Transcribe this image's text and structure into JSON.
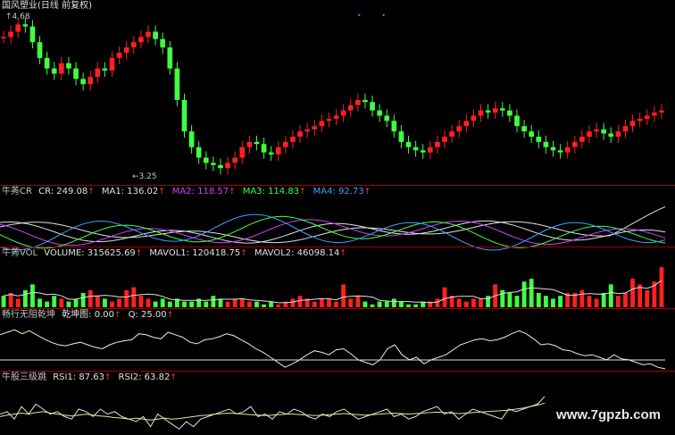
{
  "title": "国风塑业(日线 前复权)",
  "price_high": "4.68",
  "price_low": "3.25",
  "cr_panel": {
    "name": "牛莠CR",
    "items": [
      {
        "label": "CR: 249.08",
        "color": "#e0e0e0"
      },
      {
        "label": "MA1: 136.02",
        "color": "#e0e0e0"
      },
      {
        "label": "MA2: 118.57",
        "color": "#d040ff"
      },
      {
        "label": "MA3: 114.83",
        "color": "#40ff40"
      },
      {
        "label": "MA4: 92.73",
        "color": "#40a0ff"
      }
    ]
  },
  "vol_panel": {
    "name": "牛莠VOL",
    "items": [
      {
        "label": "VOLUME: 315625.69",
        "color": "#e0e0e0"
      },
      {
        "label": "MAVOL1: 120418.75",
        "color": "#e0e0e0"
      },
      {
        "label": "MAVOL2: 46098.14",
        "color": "#e0e0e0"
      }
    ]
  },
  "qk_panel": {
    "name": "畅行无阻乾坤",
    "items": [
      {
        "label": "乾坤图: 0.00",
        "color": "#e0e0e0"
      },
      {
        "label": "Q: 25.00",
        "color": "#e0e0e0"
      }
    ]
  },
  "rsi_panel": {
    "name": "牛股三级跳",
    "items": [
      {
        "label": "RSI1: 87.63",
        "color": "#e0e0e0"
      },
      {
        "label": "RSI2: 63.82",
        "color": "#e0e0e0"
      }
    ]
  },
  "watermark": "www.7gpzb.com",
  "colors": {
    "up": "#ff2020",
    "down": "#40ff40",
    "separator": "#a00000",
    "line": "#f0f0c0"
  },
  "chart_data": {
    "type": "line",
    "price_series": [
      4.5,
      4.55,
      4.62,
      4.6,
      4.45,
      4.3,
      4.2,
      4.15,
      4.25,
      4.2,
      4.1,
      4.05,
      4.12,
      4.2,
      4.18,
      4.3,
      4.35,
      4.4,
      4.45,
      4.5,
      4.55,
      4.48,
      4.4,
      4.2,
      3.9,
      3.6,
      3.45,
      3.35,
      3.3,
      3.28,
      3.25,
      3.3,
      3.35,
      3.45,
      3.5,
      3.48,
      3.4,
      3.38,
      3.45,
      3.5,
      3.55,
      3.6,
      3.62,
      3.65,
      3.7,
      3.72,
      3.75,
      3.8,
      3.85,
      3.9,
      3.88,
      3.8,
      3.75,
      3.7,
      3.6,
      3.5,
      3.45,
      3.42,
      3.4,
      3.45,
      3.5,
      3.55,
      3.6,
      3.65,
      3.7,
      3.75,
      3.8,
      3.78,
      3.82,
      3.8,
      3.75,
      3.65,
      3.6,
      3.55,
      3.5,
      3.45,
      3.42,
      3.4,
      3.45,
      3.5,
      3.55,
      3.6,
      3.62,
      3.58,
      3.55,
      3.6,
      3.65,
      3.7,
      3.72,
      3.75,
      3.78,
      3.8
    ],
    "volume_series": [
      0.4,
      0.5,
      0.3,
      0.6,
      0.8,
      0.3,
      0.2,
      0.4,
      0.3,
      0.2,
      0.3,
      0.5,
      0.6,
      0.4,
      0.3,
      0.2,
      0.3,
      0.6,
      0.7,
      0.4,
      0.3,
      0.2,
      0.3,
      0.2,
      0.3,
      0.2,
      0.2,
      0.3,
      0.2,
      0.4,
      0.3,
      0.2,
      0.3,
      0.3,
      0.2,
      0.2,
      0.1,
      0.2,
      0.1,
      0.2,
      0.3,
      0.4,
      0.3,
      0.2,
      0.3,
      0.3,
      0.2,
      0.8,
      0.3,
      0.4,
      0.2,
      0.1,
      0.2,
      0.2,
      0.3,
      0.2,
      0.1,
      0.1,
      0.2,
      0.2,
      0.3,
      0.7,
      0.4,
      0.3,
      0.2,
      0.3,
      0.3,
      0.4,
      0.8,
      0.6,
      0.5,
      0.4,
      0.9,
      1.0,
      0.5,
      0.4,
      0.3,
      0.4,
      0.5,
      0.5,
      0.6,
      0.4,
      0.3,
      0.5,
      0.8,
      0.4,
      0.5,
      1.0,
      0.8,
      0.6,
      0.9,
      1.4
    ],
    "qk_series": [
      0.7,
      0.75,
      0.8,
      0.72,
      0.78,
      0.7,
      0.62,
      0.55,
      0.5,
      0.48,
      0.52,
      0.55,
      0.5,
      0.45,
      0.42,
      0.5,
      0.55,
      0.58,
      0.6,
      0.72,
      0.7,
      0.65,
      0.62,
      0.75,
      0.7,
      0.65,
      0.55,
      0.52,
      0.6,
      0.62,
      0.66,
      0.72,
      0.68,
      0.6,
      0.52,
      0.42,
      0.35,
      0.25,
      0.15,
      0.05,
      0.12,
      0.2,
      0.3,
      0.38,
      0.35,
      0.3,
      0.4,
      0.42,
      0.32,
      0.2,
      0.15,
      0.1,
      0.2,
      0.42,
      0.5,
      0.3,
      0.2,
      0.25,
      0.12,
      0.2,
      0.25,
      0.3,
      0.4,
      0.5,
      0.55,
      0.6,
      0.62,
      0.58,
      0.6,
      0.65,
      0.72,
      0.78,
      0.72,
      0.62,
      0.5,
      0.52,
      0.48,
      0.4,
      0.38,
      0.32,
      0.28,
      0.3,
      0.25,
      0.2,
      0.3,
      0.22,
      0.2,
      0.15,
      0.1,
      0.12,
      0.05,
      0.02
    ],
    "rsi1_series": [
      0.4,
      0.45,
      0.3,
      0.55,
      0.4,
      0.6,
      0.5,
      0.4,
      0.45,
      0.35,
      0.3,
      0.5,
      0.45,
      0.35,
      0.5,
      0.4,
      0.45,
      0.35,
      0.3,
      0.25,
      0.35,
      0.15,
      0.4,
      0.3,
      0.2,
      0.1,
      0.25,
      0.15,
      0.3,
      0.35,
      0.4,
      0.45,
      0.5,
      0.4,
      0.45,
      0.55,
      0.35,
      0.4,
      0.3,
      0.45,
      0.4,
      0.5,
      0.45,
      0.35,
      0.3,
      0.4,
      0.35,
      0.45,
      0.5,
      0.4,
      0.3,
      0.35,
      0.4,
      0.45,
      0.5,
      0.35,
      0.4,
      0.3,
      0.35,
      0.45,
      0.5,
      0.55,
      0.4,
      0.45,
      0.3,
      0.4,
      0.5,
      0.45,
      0.4,
      0.35,
      0.3,
      0.5,
      0.45,
      0.5,
      0.55,
      0.6,
      0.75
    ],
    "rsi2_series": [
      0.35,
      0.38,
      0.4,
      0.42,
      0.4,
      0.43,
      0.45,
      0.42,
      0.4,
      0.38,
      0.36,
      0.38,
      0.4,
      0.38,
      0.36,
      0.35,
      0.33,
      0.32,
      0.3,
      0.32,
      0.3,
      0.28,
      0.3,
      0.32,
      0.3,
      0.31,
      0.33,
      0.35,
      0.37,
      0.38,
      0.4,
      0.41,
      0.42,
      0.41,
      0.4,
      0.39,
      0.38,
      0.37,
      0.38,
      0.39,
      0.4,
      0.4,
      0.39,
      0.38,
      0.37,
      0.38,
      0.39,
      0.4,
      0.41,
      0.4,
      0.39,
      0.38,
      0.39,
      0.4,
      0.41,
      0.42,
      0.41,
      0.4,
      0.41,
      0.42,
      0.43,
      0.44,
      0.43,
      0.42,
      0.41,
      0.42,
      0.43,
      0.44,
      0.45,
      0.46,
      0.47,
      0.48,
      0.5,
      0.52,
      0.55,
      0.58,
      0.62
    ]
  }
}
